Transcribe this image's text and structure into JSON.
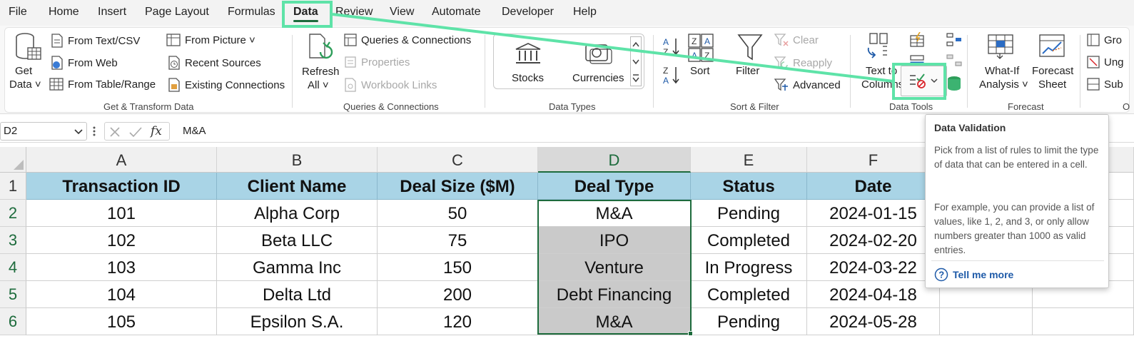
{
  "menu": {
    "items": [
      "File",
      "Home",
      "Insert",
      "Page Layout",
      "Formulas",
      "Data",
      "Review",
      "View",
      "Automate",
      "Developer",
      "Help"
    ],
    "active": "Data"
  },
  "ribbon": {
    "get_transform": {
      "get_data": "Get",
      "get_data_2": "Data ˅",
      "from_text_csv": "From Text/CSV",
      "from_web": "From Web",
      "from_table": "From Table/Range",
      "from_picture": "From Picture ˅",
      "recent_sources": "Recent Sources",
      "existing_connections": "Existing Connections",
      "label": "Get & Transform Data"
    },
    "queries": {
      "refresh_all": "Refresh",
      "refresh_all_2": "All ˅",
      "queries_connections": "Queries & Connections",
      "properties": "Properties",
      "workbook_links": "Workbook Links",
      "label": "Queries & Connections"
    },
    "data_types": {
      "stocks": "Stocks",
      "currencies": "Currencies",
      "label": "Data Types"
    },
    "sort_filter": {
      "sort": "Sort",
      "filter": "Filter",
      "clear": "Clear",
      "reapply": "Reapply",
      "advanced": "Advanced",
      "label": "Sort & Filter"
    },
    "data_tools": {
      "text_to_columns": "Text to",
      "text_to_columns_2": "Columns",
      "label": "Data Tools"
    },
    "forecast": {
      "what_if": "What-If",
      "what_if_2": "Analysis ˅",
      "forecast_sheet": "Forecast",
      "forecast_sheet_2": "Sheet",
      "label": "Forecast"
    },
    "outline": {
      "group": "Gro",
      "ungroup": "Ung",
      "subtotal": "Sub",
      "label": "O"
    }
  },
  "formula_bar": {
    "name_box": "D2",
    "fx": "fx",
    "value": "M&A"
  },
  "sheet": {
    "columns": [
      "A",
      "B",
      "C",
      "D",
      "E",
      "F"
    ],
    "rows": [
      "1",
      "2",
      "3",
      "4",
      "5",
      "6"
    ],
    "header": [
      "Transaction ID",
      "Client Name",
      "Deal Size ($M)",
      "Deal Type",
      "Status",
      "Date"
    ],
    "data": [
      [
        "101",
        "Alpha Corp",
        "50",
        "M&A",
        "Pending",
        "2024-01-15"
      ],
      [
        "102",
        "Beta LLC",
        "75",
        "IPO",
        "Completed",
        "2024-02-20"
      ],
      [
        "103",
        "Gamma Inc",
        "150",
        "Venture",
        "In Progress",
        "2024-03-22"
      ],
      [
        "104",
        "Delta Ltd",
        "200",
        "Debt Financing",
        "Completed",
        "2024-04-18"
      ],
      [
        "105",
        "Epsilon S.A.",
        "120",
        "M&A",
        "Pending",
        "2024-05-28"
      ]
    ]
  },
  "tooltip": {
    "title": "Data Validation",
    "body_1": "Pick from a list of rules to limit the type of data that can be entered in a cell.",
    "body_2": "For example, you can provide a list of values, like 1, 2, and 3, or only allow numbers greater than 1000 as valid entries.",
    "link": "Tell me more"
  },
  "colors": {
    "header_fill": "#a9d4e6",
    "highlight": "#5ee3a8",
    "excel_green": "#1d6b3c",
    "selected_fill": "#cacaca"
  }
}
